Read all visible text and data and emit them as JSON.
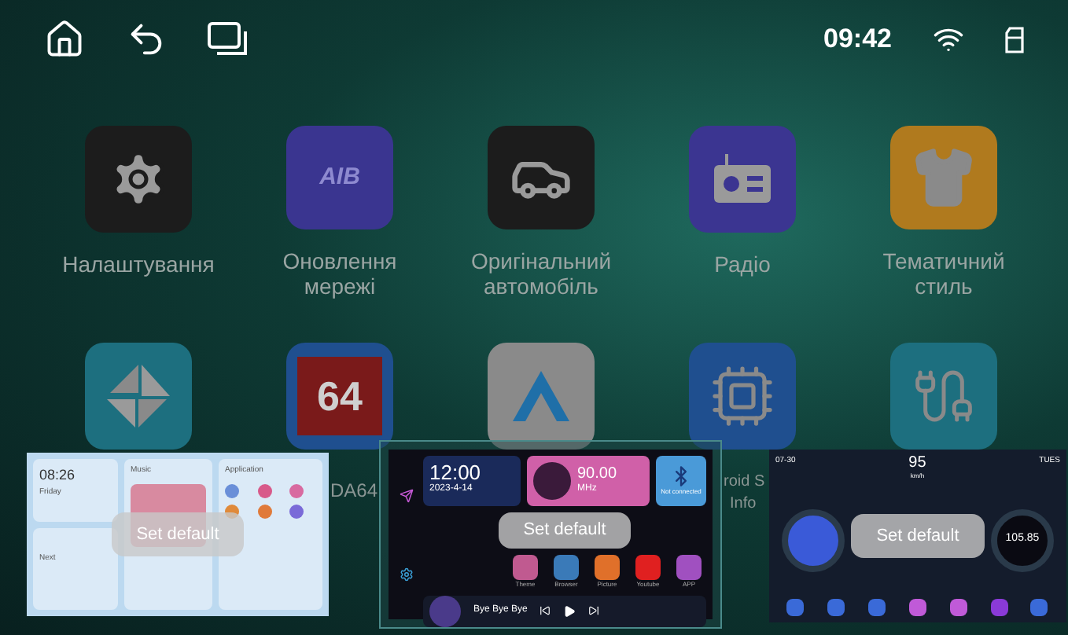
{
  "status_bar": {
    "time": "09:42"
  },
  "apps": [
    {
      "kind": "gear",
      "label": "Налаштування"
    },
    {
      "kind": "logo",
      "logo_text": "AIB",
      "label": "Оновлення мережі"
    },
    {
      "kind": "car",
      "label": "Оригінальний автомобіль"
    },
    {
      "kind": "radio",
      "label": "Радіо"
    },
    {
      "kind": "shirt",
      "label": "Тематичний стиль"
    },
    {
      "kind": "diamond"
    },
    {
      "kind": "number",
      "tile_text": "64"
    },
    {
      "kind": "arrow"
    },
    {
      "kind": "cpu"
    },
    {
      "kind": "cable"
    }
  ],
  "partial_labels": [
    "DA64",
    "roid S",
    "Info"
  ],
  "theme_previews": [
    {
      "kind": "light",
      "selected": false,
      "clock": "08:26",
      "day": "Friday",
      "music_title": "Music",
      "apps_title": "Application",
      "nav": "Next",
      "button": "Set default"
    },
    {
      "kind": "dark",
      "selected": true,
      "clock": "12:00",
      "date": "2023-4-14",
      "frequency": "90.00",
      "unit": "MHz",
      "bt_status": "Not connected",
      "shortcuts": [
        "Theme",
        "Browser",
        "Picture",
        "Youtube",
        "APP"
      ],
      "song": "Bye Bye Bye",
      "button": "Set default"
    },
    {
      "kind": "car",
      "selected": false,
      "date": "07-30",
      "speed": "95",
      "speed_unit": "km/h",
      "weekday": "TUES",
      "frequency": "105.85",
      "button": "Set default"
    }
  ]
}
